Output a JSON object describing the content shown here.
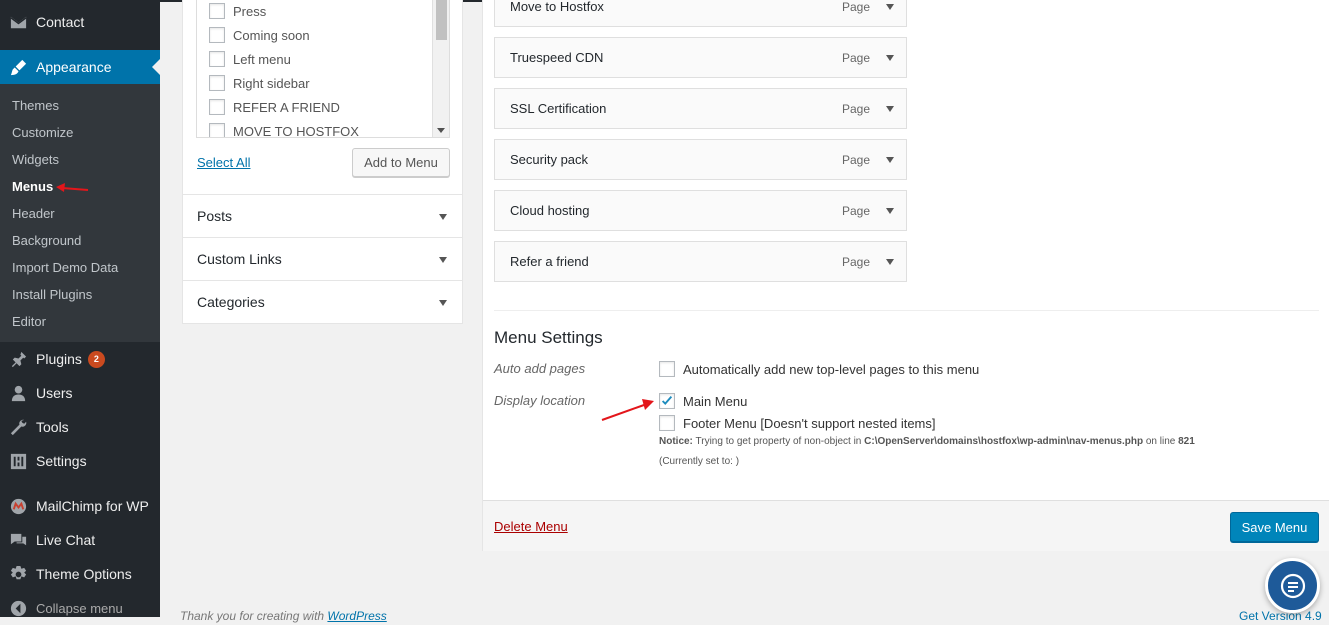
{
  "sidebar": {
    "items": [
      {
        "label": "Contact",
        "icon": "mail-icon"
      },
      {
        "label": "Appearance",
        "icon": "brush-icon"
      },
      {
        "label": "Plugins",
        "icon": "plugin-icon",
        "badge": "2"
      },
      {
        "label": "Users",
        "icon": "users-icon"
      },
      {
        "label": "Tools",
        "icon": "wrench-icon"
      },
      {
        "label": "Settings",
        "icon": "settings-icon"
      },
      {
        "label": "MailChimp for WP",
        "icon": "mailchimp-icon"
      },
      {
        "label": "Live Chat",
        "icon": "chat-icon"
      },
      {
        "label": "Theme Options",
        "icon": "gear-icon"
      },
      {
        "label": "Collapse menu",
        "icon": "collapse-icon"
      }
    ],
    "appearance_submenu": [
      "Themes",
      "Customize",
      "Widgets",
      "Menus",
      "Header",
      "Background",
      "Import Demo Data",
      "Install Plugins",
      "Editor"
    ],
    "current_submenu": "Menus"
  },
  "pages_box": {
    "pages": [
      "Press",
      "Coming soon",
      "Left menu",
      "Right sidebar",
      "REFER A FRIEND",
      "MOVE TO HOSTFOX"
    ],
    "select_all": "Select All",
    "add_to_menu": "Add to Menu"
  },
  "accordions": [
    "Posts",
    "Custom Links",
    "Categories"
  ],
  "menu_items": [
    {
      "title": "Move to Hostfox",
      "type": "Page"
    },
    {
      "title": "Truespeed CDN",
      "type": "Page"
    },
    {
      "title": "SSL Certification",
      "type": "Page"
    },
    {
      "title": "Security pack",
      "type": "Page"
    },
    {
      "title": "Cloud hosting",
      "type": "Page"
    },
    {
      "title": "Refer a friend",
      "type": "Page"
    }
  ],
  "menu_settings": {
    "title": "Menu Settings",
    "auto_add_label": "Auto add pages",
    "auto_add_option": "Automatically add new top-level pages to this menu",
    "auto_add_checked": false,
    "display_location_label": "Display location",
    "locations": [
      {
        "label": "Main Menu",
        "checked": true
      },
      {
        "label": "Footer Menu [Doesn't support nested items]",
        "checked": false
      }
    ],
    "notice_prefix": "Notice:",
    "notice_text": "Trying to get property of non-object in",
    "notice_path": "C:\\OpenServer\\domains\\hostfox\\wp-admin\\nav-menus.php",
    "notice_on_line": "on line",
    "notice_line": "821",
    "currently_set": "(Currently set to: )"
  },
  "actions": {
    "delete_menu": "Delete Menu",
    "save_menu": "Save Menu"
  },
  "footer": {
    "thanks_prefix": "Thank you for creating with",
    "thanks_link": "WordPress",
    "version": "Get Version 4.9"
  },
  "colors": {
    "sidebar_bg": "#23282d",
    "submenu_bg": "#32373c",
    "accent": "#0073aa",
    "primary_button": "#0085ba",
    "badge": "#ca4a1f",
    "annotation_arrow": "#e3161b",
    "chat_bubble": "#1e5a99"
  }
}
